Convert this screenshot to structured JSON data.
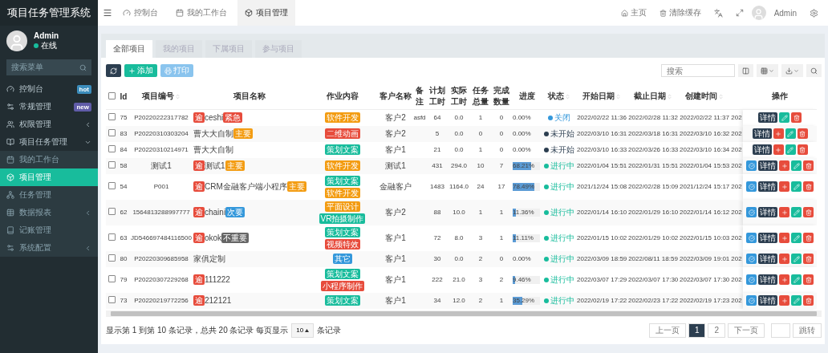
{
  "sidebar": {
    "title": "项目任务管理系统",
    "user": {
      "name": "Admin",
      "status": "在线"
    },
    "search": {
      "placeholder": "搜索菜单"
    },
    "items": [
      {
        "label": "控制台",
        "badge": {
          "text": "hot",
          "color": "#3c8dbc"
        },
        "selected": false
      },
      {
        "label": "常规管理",
        "badge": {
          "text": "new",
          "color": "#605ca8"
        },
        "selected": false
      },
      {
        "label": "权限管理",
        "expanded": false,
        "selected": false
      },
      {
        "label": "项目任务管理",
        "expanded": true,
        "selected": false,
        "children": [
          {
            "label": "我的工作台",
            "selected": false
          },
          {
            "label": "项目管理",
            "selected": true
          },
          {
            "label": "任务管理",
            "selected": false
          },
          {
            "label": "数据报表",
            "expanded": false,
            "selected": false
          },
          {
            "label": "记账管理",
            "selected": false
          },
          {
            "label": "系统配置",
            "expanded": false,
            "selected": false
          }
        ]
      }
    ]
  },
  "topbar": {
    "tabs": [
      {
        "label": "控制台",
        "selected": false
      },
      {
        "label": "我的工作台",
        "selected": false
      },
      {
        "label": "项目管理",
        "selected": true
      }
    ],
    "links": [
      "主页",
      "清除缓存"
    ],
    "user": "Admin"
  },
  "content_tabs": [
    {
      "label": "全部项目",
      "selected": true
    },
    {
      "label": "我的项目",
      "selected": false
    },
    {
      "label": "下属项目",
      "selected": false
    },
    {
      "label": "参与项目",
      "selected": false
    }
  ],
  "toolbar": {
    "add": "添加",
    "print": "打印",
    "search_placeholder": "搜索"
  },
  "table": {
    "header_checked": false,
    "columns": [
      {
        "label": "Id",
        "sortable": false
      },
      {
        "label": "项目编号",
        "sortable": true
      },
      {
        "label": "项目名称",
        "sortable": false
      },
      {
        "label": "作业内容",
        "sortable": false
      },
      {
        "label": "客户名称",
        "sortable": false
      },
      {
        "label": "备注",
        "sortable": false
      },
      {
        "label": "计划工时",
        "sortable": false
      },
      {
        "label": "实际工时",
        "sortable": false
      },
      {
        "label": "任务总量",
        "sortable": false
      },
      {
        "label": "完成数量",
        "sortable": false
      },
      {
        "label": "进度",
        "sortable": false
      },
      {
        "label": "状态",
        "sortable": true
      },
      {
        "label": "开始日期",
        "sortable": true
      },
      {
        "label": "截止日期",
        "sortable": true
      },
      {
        "label": "创建时间",
        "sortable": true
      },
      {
        "label": "操作",
        "sortable": false
      }
    ],
    "rows": [
      {
        "checked": false,
        "id": "75",
        "code": "P20220222317782",
        "flag": "逾",
        "name": "ceshi",
        "priority": {
          "label": "紧急",
          "color": "#e74c3c"
        },
        "work": [
          {
            "label": "软件开发",
            "color": "#f39c12"
          }
        ],
        "client": "客户2",
        "note": "asfd",
        "plan": "64",
        "actual": "0.0",
        "total": "1",
        "done": "0",
        "progress": {
          "level": 0,
          "text": "0.00%"
        },
        "status": {
          "label": "关闭",
          "color": "#3498db"
        },
        "start": "2022/02/22 11:36",
        "end": "2022/02/28 11:32",
        "created": "2022/02/22 11:37",
        "column_16": "202",
        "actions": [
          {
            "kind": "detail",
            "label": "详情"
          },
          {
            "kind": "edit"
          },
          {
            "kind": "delete"
          }
        ]
      },
      {
        "checked": false,
        "id": "83",
        "code": "P20220310303204",
        "name": "曹大大自制",
        "priority": {
          "label": "主要",
          "color": "#f39c12"
        },
        "work": [
          {
            "label": "二维动画",
            "color": "#e74c3c"
          }
        ],
        "client": "客户2",
        "plan": "5",
        "actual": "0.0",
        "total": "0",
        "done": "0",
        "progress": {
          "level": 0,
          "text": "0.00%"
        },
        "status": {
          "label": "未开始",
          "color": "#2c3e50"
        },
        "start": "2022/03/10 16:31",
        "end": "2022/03/18 16:31",
        "created": "2022/03/10 16:32",
        "column_16": "202",
        "actions": [
          {
            "kind": "detail",
            "label": "详情"
          },
          {
            "kind": "add"
          },
          {
            "kind": "edit"
          },
          {
            "kind": "delete"
          }
        ]
      },
      {
        "checked": false,
        "id": "84",
        "code": "P20220310214971",
        "name": "曹大大自制",
        "work": [
          {
            "label": "策划文案",
            "color": "#18bc9c"
          }
        ],
        "client": "客户1",
        "plan": "21",
        "actual": "0.0",
        "total": "1",
        "done": "0",
        "progress": {
          "level": 0,
          "text": "0.00%"
        },
        "status": {
          "label": "未开始",
          "color": "#2c3e50"
        },
        "start": "2022/03/10 16:33",
        "end": "2022/03/26 16:33",
        "created": "2022/03/10 16:34",
        "column_16": "202",
        "actions": [
          {
            "kind": "detail",
            "label": "详情"
          },
          {
            "kind": "add"
          },
          {
            "kind": "edit"
          },
          {
            "kind": "delete"
          }
        ]
      },
      {
        "checked": false,
        "id": "58",
        "code": "测试1",
        "flag": "逾",
        "name": "测试1",
        "priority": {
          "label": "主要",
          "color": "#f39c12"
        },
        "work": [
          {
            "label": "软件开发",
            "color": "#f39c12"
          }
        ],
        "client": "测试1",
        "plan": "431",
        "actual": "294.0",
        "total": "10",
        "done": "7",
        "progress": {
          "level": 0.6821,
          "text": "68.21%"
        },
        "status": {
          "label": "进行中",
          "color": "#18bc9c"
        },
        "start": "2022/01/04 15:51",
        "end": "2022/01/31 15:51",
        "created": "2022/01/04 15:53",
        "column_16": "202",
        "actions": [
          {
            "kind": "approve"
          },
          {
            "kind": "detail",
            "label": "详情"
          },
          {
            "kind": "add"
          },
          {
            "kind": "edit"
          },
          {
            "kind": "delete"
          }
        ]
      },
      {
        "checked": false,
        "id": "54",
        "code": "P001",
        "flag": "逾",
        "name": "CRM金融客户端小程序",
        "priority": {
          "label": "主要",
          "color": "#f39c12"
        },
        "work": [
          {
            "label": "策划文案",
            "color": "#18bc9c"
          },
          {
            "label": "软件开发",
            "color": "#f39c12"
          }
        ],
        "client": "金融客户",
        "plan": "1483",
        "actual": "1164.0",
        "total": "24",
        "done": "17",
        "progress": {
          "level": 0.7849,
          "text": "78.49%"
        },
        "status": {
          "label": "进行中",
          "color": "#18bc9c"
        },
        "start": "2021/12/24 15:08",
        "end": "2022/02/28 15:09",
        "created": "2021/12/24 15:17",
        "column_16": "202",
        "actions": [
          {
            "kind": "approve"
          },
          {
            "kind": "detail",
            "label": "详情"
          },
          {
            "kind": "add"
          },
          {
            "kind": "edit"
          },
          {
            "kind": "delete"
          }
        ]
      },
      {
        "checked": false,
        "id": "62",
        "code": "1564813288997777",
        "flag": "逾",
        "name": "chaini",
        "priority": {
          "label": "次要",
          "color": "#3498db"
        },
        "work": [
          {
            "label": "平面设计",
            "color": "#f39c12"
          },
          {
            "label": "VR拍摄制作",
            "color": "#18bc9c"
          }
        ],
        "client": "客户2",
        "plan": "88",
        "actual": "10.0",
        "total": "1",
        "done": "1",
        "progress": {
          "level": 0.1136,
          "text": "11.36%"
        },
        "status": {
          "label": "进行中",
          "color": "#18bc9c"
        },
        "start": "2022/01/14 16:10",
        "end": "2022/01/29 16:10",
        "created": "2022/01/14 16:12",
        "column_16": "202",
        "actions": [
          {
            "kind": "approve"
          },
          {
            "kind": "detail",
            "label": "详情"
          },
          {
            "kind": "add"
          },
          {
            "kind": "edit"
          },
          {
            "kind": "delete"
          }
        ]
      },
      {
        "checked": false,
        "id": "63",
        "code": "JD546697484116500",
        "flag": "逾",
        "name": "okok",
        "priority": {
          "label": "不重要",
          "color": "#666666"
        },
        "work": [
          {
            "label": "策划文案",
            "color": "#18bc9c"
          },
          {
            "label": "视频特效",
            "color": "#e74c3c"
          }
        ],
        "client": "客户1",
        "plan": "72",
        "actual": "8.0",
        "total": "3",
        "done": "1",
        "progress": {
          "level": 0.1111,
          "text": "11.11%"
        },
        "status": {
          "label": "进行中",
          "color": "#18bc9c"
        },
        "start": "2022/01/15 10:02",
        "end": "2022/01/29 10:02",
        "created": "2022/01/15 10:03",
        "column_16": "202",
        "actions": [
          {
            "kind": "approve"
          },
          {
            "kind": "detail",
            "label": "详情"
          },
          {
            "kind": "add"
          },
          {
            "kind": "edit"
          },
          {
            "kind": "delete"
          }
        ]
      },
      {
        "checked": false,
        "id": "80",
        "code": "P20220309685958",
        "name": "家俱定制",
        "work": [
          {
            "label": "其它",
            "color": "#3498db"
          }
        ],
        "client": "客户1",
        "plan": "30",
        "actual": "0.0",
        "total": "2",
        "done": "0",
        "progress": {
          "level": 0,
          "text": "0.00%"
        },
        "status": {
          "label": "进行中",
          "color": "#18bc9c"
        },
        "start": "2022/03/09 18:59",
        "end": "2022/08/11 18:59",
        "created": "2022/03/09 19:01",
        "column_16": "202",
        "actions": [
          {
            "kind": "approve"
          },
          {
            "kind": "detail",
            "label": "详情"
          },
          {
            "kind": "add"
          },
          {
            "kind": "edit"
          },
          {
            "kind": "delete"
          }
        ]
      },
      {
        "checked": false,
        "id": "79",
        "code": "P20220307229268",
        "flag": "逾",
        "name": "111222",
        "work": [
          {
            "label": "策划文案",
            "color": "#18bc9c"
          },
          {
            "label": "小程序制作",
            "color": "#e74c3c"
          }
        ],
        "client": "客户1",
        "plan": "222",
        "actual": "21.0",
        "total": "3",
        "done": "2",
        "progress": {
          "level": 0.0946,
          "text": "9.46%"
        },
        "status": {
          "label": "进行中",
          "color": "#18bc9c"
        },
        "start": "2022/03/07 17:29",
        "end": "2022/03/07 17:30",
        "created": "2022/03/07 17:30",
        "column_16": "202",
        "actions": [
          {
            "kind": "approve"
          },
          {
            "kind": "detail",
            "label": "详情"
          },
          {
            "kind": "add"
          },
          {
            "kind": "edit"
          },
          {
            "kind": "delete"
          }
        ]
      },
      {
        "checked": false,
        "id": "73",
        "code": "P20220219772256",
        "flag": "逾",
        "name": "212121",
        "work": [
          {
            "label": "策划文案",
            "color": "#18bc9c"
          }
        ],
        "client": "客户1",
        "plan": "34",
        "actual": "12.0",
        "total": "2",
        "done": "1",
        "progress": {
          "level": 0.3529,
          "text": "35.29%"
        },
        "status": {
          "label": "进行中",
          "color": "#18bc9c"
        },
        "start": "2022/02/19 17:22",
        "end": "2022/02/23 17:22",
        "created": "2022/02/19 17:23",
        "column_16": "202",
        "actions": [
          {
            "kind": "approve"
          },
          {
            "kind": "detail",
            "label": "详情"
          },
          {
            "kind": "add"
          },
          {
            "kind": "edit"
          },
          {
            "kind": "delete"
          }
        ]
      }
    ]
  },
  "footer": {
    "summary": "显示第 1 到第 10 条记录，总共 20 条记录 每页显示",
    "page_size": "10",
    "page_size_suffix": "条记录",
    "prev": "上一页",
    "pages": [
      {
        "label": "1",
        "selected": true
      },
      {
        "label": "2",
        "selected": false
      }
    ],
    "next": "下一页",
    "jump": "跳转"
  }
}
